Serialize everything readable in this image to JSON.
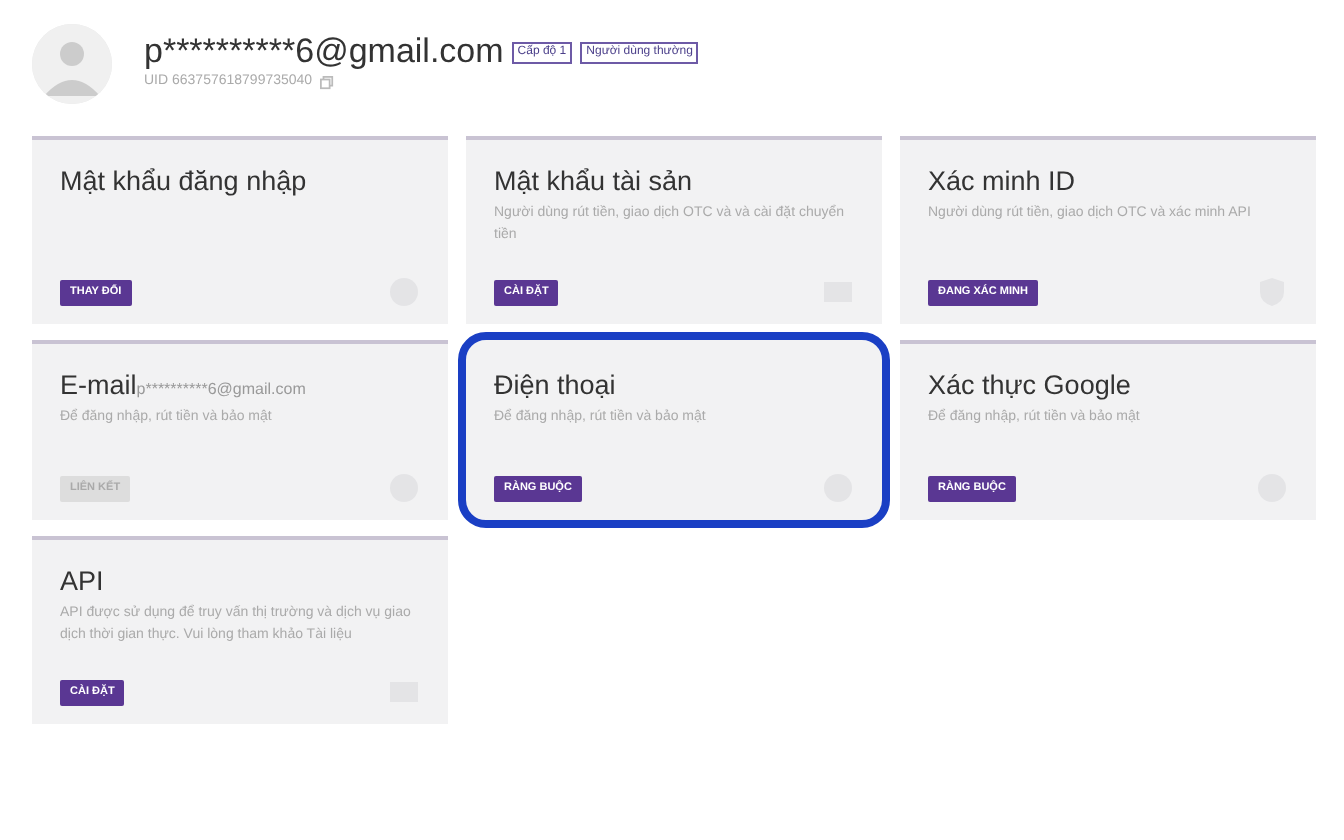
{
  "profile": {
    "email": "p**********6@gmail.com",
    "badges": [
      "Cấp độ 1",
      "Người dùng thường"
    ],
    "uid": "UID 663757618799735040"
  },
  "cards": [
    {
      "kind": "round",
      "title": "Mật khẩu đăng nhập",
      "button": "THAY ĐỔI",
      "disabled": false,
      "highlighted": false
    },
    {
      "kind": "card",
      "title": "Mật khẩu tài sản",
      "description": "Người dùng rút tiền, giao dịch OTC và và cài đặt chuyển tiền",
      "button": "CÀI ĐẶT",
      "disabled": false,
      "highlighted": false
    },
    {
      "kind": "shield",
      "title": "Xác minh ID",
      "description": "Người dùng rút tiền, giao dịch OTC và xác minh API",
      "button": "ĐANG XÁC MINH",
      "disabled": false,
      "highlighted": false
    },
    {
      "kind": "round",
      "title": "E-mail",
      "title_suffix": "p**********6@gmail.com",
      "description": "Để đăng nhập, rút tiền và bảo mật",
      "button": "LIÊN KẾT",
      "disabled": true,
      "highlighted": false
    },
    {
      "kind": "round",
      "title": "Điện thoại",
      "description": "Để đăng nhập, rút tiền và bảo mật",
      "button": "RÀNG BUỘC",
      "disabled": false,
      "highlighted": true
    },
    {
      "kind": "round",
      "title": "Xác thực Google",
      "description": "Để đăng nhập, rút tiền và bảo mật",
      "button": "RÀNG BUỘC",
      "disabled": false,
      "highlighted": false
    },
    {
      "kind": "card",
      "title": "API",
      "description": "API được sử dụng để truy vấn thị trường và dịch vụ giao dịch thời gian thực. Vui lòng tham khảo Tài liệu",
      "button": "CÀI ĐẶT",
      "disabled": false,
      "highlighted": false
    }
  ]
}
